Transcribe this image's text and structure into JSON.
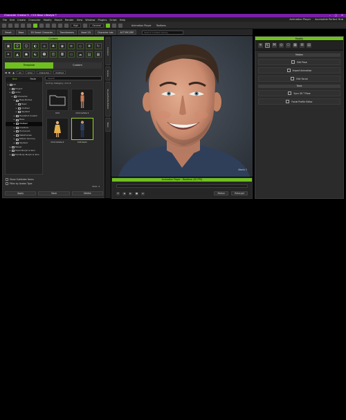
{
  "window": {
    "title": "Character Creator 5 - CC4 Base Lifestyle *",
    "controls": [
      "–",
      "▢",
      "✕"
    ]
  },
  "menu": {
    "items": [
      "File",
      "Edit",
      "Create",
      "Character",
      "Modify",
      "Morph",
      "Render",
      "View",
      "Window",
      "Plugins",
      "Script",
      "Help"
    ],
    "right": [
      "Animation Player",
      "Accessible Perfect Hub"
    ]
  },
  "toolbar": {
    "quality": "High",
    "display_mode": "General",
    "anim_player": "Animation Player",
    "toolbars": "Toolbars"
  },
  "tabs2": {
    "items": [
      "Smart",
      "Base",
      "3D Smart Character",
      "Transformers",
      "Voxel 2D",
      "Character Lab",
      "ACTORCORE"
    ],
    "search_placeholder": "Search Content Library"
  },
  "content": {
    "title": "Content",
    "tabs": {
      "template": "Template",
      "custom": "Custom"
    },
    "breadcrumb": [
      "All",
      "Actor",
      "Character",
      "Clothed"
    ],
    "tree_header": {
      "new": "New",
      "paste": "Paste"
    },
    "tree": [
      {
        "label": "All",
        "indent": 0
      },
      {
        "label": "Project",
        "indent": 1
      },
      {
        "label": "Actor",
        "indent": 1
      },
      {
        "label": "Character",
        "indent": 2
      },
      {
        "label": "Base Bodies",
        "indent": 3
      },
      {
        "label": "Basic",
        "indent": 4
      },
      {
        "label": "Clothed",
        "indent": 4
      },
      {
        "label": "Stylized",
        "indent": 4
      },
      {
        "label": "Headshot Creator",
        "indent": 3
      },
      {
        "label": "Base",
        "indent": 3
      },
      {
        "label": "Clothed",
        "indent": 3,
        "selected": true
      },
      {
        "label": "Creature",
        "indent": 3
      },
      {
        "label": "Humanoid",
        "indent": 3
      },
      {
        "label": "MetaHuman",
        "indent": 3
      },
      {
        "label": "Motion Dummy",
        "indent": 3
      },
      {
        "label": "Stylized",
        "indent": 3
      },
      {
        "label": "Morph",
        "indent": 1
      },
      {
        "label": "Head Morph & Skin",
        "indent": 1
      },
      {
        "label": "Full Body Morph & Skin",
        "indent": 1
      }
    ],
    "search_placeholder": "Search",
    "sort_label": "Sort by Category, A to Z",
    "thumbnails": [
      {
        "caption": "CC4"
      },
      {
        "caption": "CC4 Camila 1"
      },
      {
        "caption": "CC4 Camila 2"
      },
      {
        "caption": "CC4 Kevin"
      }
    ],
    "checks": [
      "Show Subfolder Items",
      "Filter by Avatar Type"
    ],
    "pager": "Total: 4",
    "buttons": [
      "Apply",
      "Save",
      "Delete"
    ]
  },
  "sidetabs": [
    "Content",
    "Scene",
    "Visual Profile Editor",
    "Tools"
  ],
  "viewport": {
    "label": "Kevin 1"
  },
  "anim": {
    "title": "Animation Player : Realtime (30 FPS)",
    "buttons": [
      "Motion",
      "Retarget"
    ],
    "playback": [
      "⏮",
      "◀",
      "▶",
      "■",
      "⏭"
    ]
  },
  "modify": {
    "title": "Modify",
    "tab_icons": [
      "≡",
      "✎",
      "⌘",
      "◎",
      "⎔",
      "▦",
      "⊞",
      "▤"
    ],
    "sections": [
      {
        "header": "Motion",
        "rows": [
          "Edit Pose",
          "Import Animation",
          "Edit Facial"
        ]
      },
      {
        "header": "Tools",
        "rows": [
          "Sync SK T Pose",
          "Facial Profile Editor"
        ]
      }
    ]
  },
  "colors": {
    "accent": "#6fbf1f",
    "titlebar": "#7a1ea6"
  }
}
